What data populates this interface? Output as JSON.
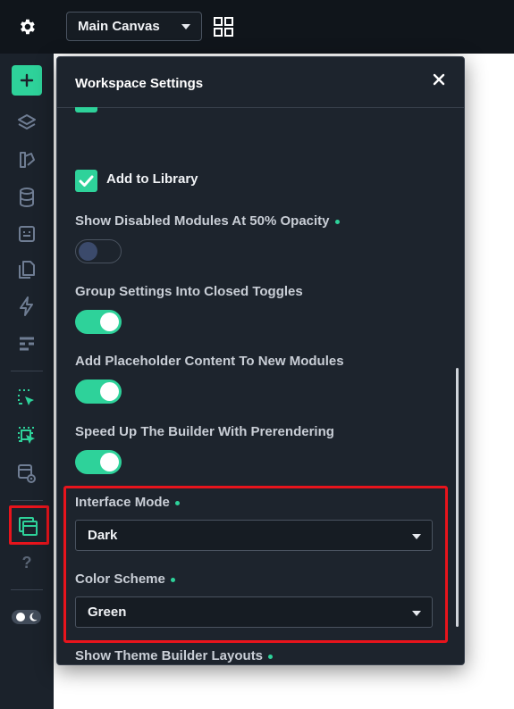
{
  "topbar": {
    "canvas_select_value": "Main Canvas"
  },
  "sidebar": {
    "items": [
      {
        "icon": "gear-icon"
      },
      {
        "icon": "add-icon"
      },
      {
        "icon": "layers-icon"
      },
      {
        "icon": "theme-builder-icon"
      },
      {
        "icon": "database-icon"
      },
      {
        "icon": "portability-icon"
      },
      {
        "icon": "pages-icon"
      },
      {
        "icon": "lightning-icon"
      },
      {
        "icon": "structure-icon"
      },
      {
        "icon": "select-cursor-icon"
      },
      {
        "icon": "multi-select-icon"
      },
      {
        "icon": "preview-icon"
      },
      {
        "icon": "workspace-icon"
      },
      {
        "icon": "help-icon"
      },
      {
        "icon": "mode-toggle-icon"
      }
    ],
    "help_label": "?"
  },
  "modal": {
    "title": "Workspace Settings",
    "add_to_library": {
      "label": "Add to Library",
      "checked": true
    },
    "settings": [
      {
        "label": "Show Disabled Modules At 50% Opacity",
        "on": false,
        "dot": true
      },
      {
        "label": "Group Settings Into Closed Toggles",
        "on": true,
        "dot": false
      },
      {
        "label": "Add Placeholder Content To New Modules",
        "on": true,
        "dot": false
      },
      {
        "label": "Speed Up The Builder With Prerendering",
        "on": true,
        "dot": false
      }
    ],
    "interface_mode": {
      "label": "Interface Mode",
      "value": "Dark"
    },
    "color_scheme": {
      "label": "Color Scheme",
      "value": "Green"
    },
    "theme_builder_layouts": {
      "label": "Show Theme Builder Layouts",
      "on": false
    }
  },
  "colors": {
    "accent": "#2ed29a",
    "highlight": "#e8141c",
    "panel": "#1d242d",
    "sidebar": "#1b222b"
  }
}
